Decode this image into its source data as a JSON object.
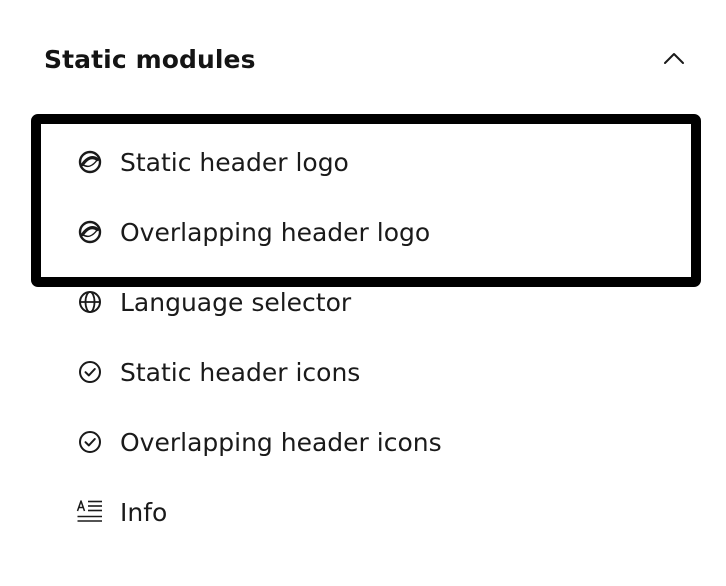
{
  "section": {
    "title": "Static modules",
    "toggle_icon": "chevron-up-icon"
  },
  "modules": [
    {
      "label": "Static header logo",
      "icon": "logo-icon"
    },
    {
      "label": "Overlapping header logo",
      "icon": "logo-icon"
    },
    {
      "label": "Language selector",
      "icon": "globe-icon"
    },
    {
      "label": "Static header icons",
      "icon": "check-circle-icon"
    },
    {
      "label": "Overlapping header icons",
      "icon": "check-circle-icon"
    },
    {
      "label": "Info",
      "icon": "text-format-icon"
    }
  ],
  "highlight": {
    "color": "#000000",
    "covers_items": [
      "Static header logo",
      "Overlapping header logo"
    ]
  }
}
